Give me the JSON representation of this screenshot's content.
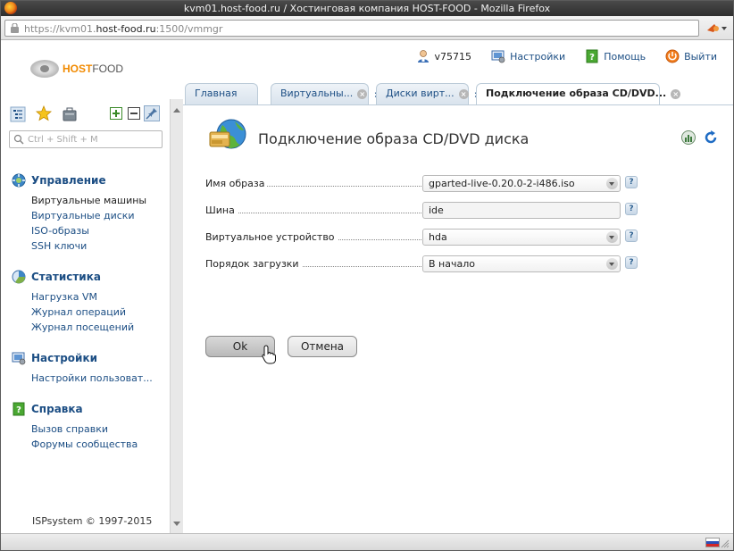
{
  "browser": {
    "title": "kvm01.host-food.ru / Хостинговая компания HOST-FOOD - Mozilla Firefox",
    "url_prefix": "https://kvm01.",
    "url_host": "host-food.ru",
    "url_suffix": ":1500/vmmgr"
  },
  "header": {
    "logo_host": "HOST",
    "logo_food": "FOOD",
    "user": "v75715",
    "settings": "Настройки",
    "help": "Помощь",
    "logout": "Выйти"
  },
  "sidebar": {
    "search_placeholder": "Ctrl + Shift + M",
    "sections": [
      {
        "title": "Управление",
        "items": [
          "Виртуальные машины",
          "Виртуальные диски",
          "ISO-образы",
          "SSH ключи"
        ]
      },
      {
        "title": "Статистика",
        "items": [
          "Нагрузка VM",
          "Журнал операций",
          "Журнал посещений"
        ]
      },
      {
        "title": "Настройки",
        "items": [
          "Настройки пользоват..."
        ]
      },
      {
        "title": "Справка",
        "items": [
          "Вызов справки",
          "Форумы сообщества"
        ]
      }
    ],
    "copyright": "ISPsystem © 1997-2015"
  },
  "tabs": [
    {
      "label": "Главная"
    },
    {
      "label": "Виртуальны..."
    },
    {
      "label": "Диски вирт..."
    },
    {
      "label": "Подключение образа CD/DVD..."
    }
  ],
  "form": {
    "title": "Подключение образа CD/DVD диска",
    "fields": [
      {
        "label": "Имя образа",
        "value": "gparted-live-0.20.0-2-i486.iso",
        "type": "select"
      },
      {
        "label": "Шина",
        "value": "ide",
        "type": "input"
      },
      {
        "label": "Виртуальное устройство",
        "value": "hda",
        "type": "select"
      },
      {
        "label": "Порядок загрузки",
        "value": "В начало",
        "type": "select"
      }
    ],
    "help_glyph": "?",
    "ok": "Ok",
    "cancel": "Отмена"
  },
  "colors": {
    "link": "#1c4e84",
    "brand": "#f18a00",
    "tab_border": "#bccbd8"
  },
  "icons": [
    "firefox-icon",
    "lock-icon",
    "user-icon",
    "settings-icon",
    "help-icon",
    "power-icon",
    "tree-icon",
    "star-icon",
    "briefcase-icon",
    "expand-icon",
    "collapse-icon",
    "pin-icon",
    "search-icon",
    "gear-icon",
    "chart-icon",
    "monitor-icon",
    "book-icon",
    "globe-disk-icon",
    "refresh-icon",
    "flag-ru-icon"
  ]
}
